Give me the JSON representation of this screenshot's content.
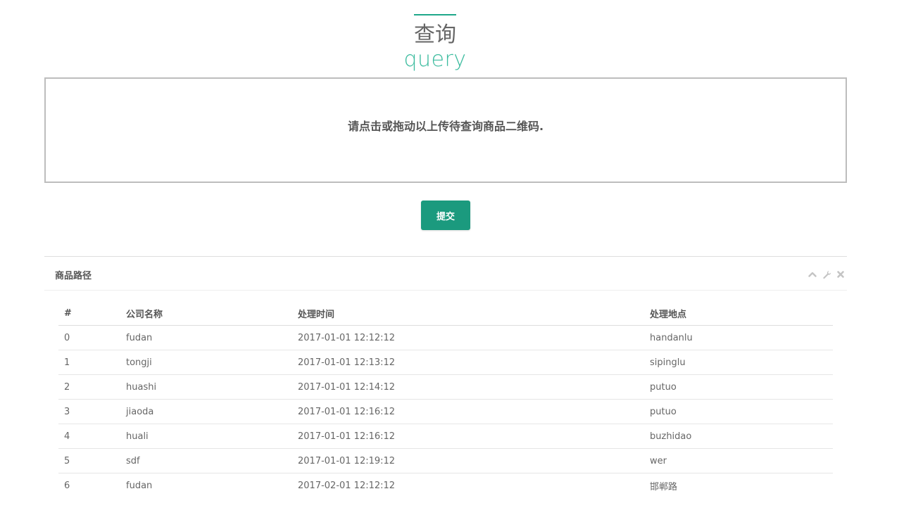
{
  "heading": {
    "title": "查询",
    "subtitle": "query"
  },
  "dropzone": {
    "message": "请点击或拖动以上传待查询商品二维码."
  },
  "submit": {
    "label": "提交"
  },
  "panel": {
    "title": "商品路径",
    "tools": [
      "chevron-up-icon",
      "wrench-icon",
      "close-icon"
    ]
  },
  "table": {
    "headers": [
      "#",
      "公司名称",
      "处理时间",
      "处理地点"
    ],
    "rows": [
      [
        "0",
        "fudan",
        "2017-01-01 12:12:12",
        "handanlu"
      ],
      [
        "1",
        "tongji",
        "2017-01-01 12:13:12",
        "sipinglu"
      ],
      [
        "2",
        "huashi",
        "2017-01-01 12:14:12",
        "putuo"
      ],
      [
        "3",
        "jiaoda",
        "2017-01-01 12:16:12",
        "putuo"
      ],
      [
        "4",
        "huali",
        "2017-01-01 12:16:12",
        "buzhidao"
      ],
      [
        "5",
        "sdf",
        "2017-01-01 12:19:12",
        "wer"
      ],
      [
        "6",
        "fudan",
        "2017-02-01 12:12:12",
        "邯郸路"
      ]
    ]
  },
  "colors": {
    "accent": "#1b9a7e",
    "accent_light": "#3dbc9f"
  }
}
